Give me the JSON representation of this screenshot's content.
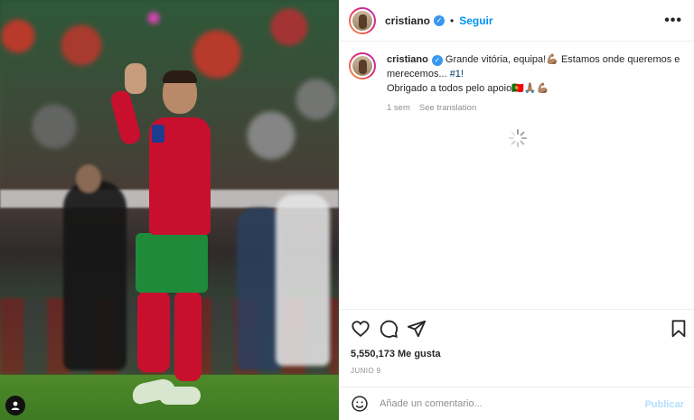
{
  "post": {
    "username": "cristiano",
    "verified": true,
    "follow_label": "Seguir",
    "more_label": "•••"
  },
  "caption": {
    "username": "cristiano",
    "text_1": "Grande vitória, equipa!💪🏽 Estamos onde queremos e merecemos... ",
    "hashtag": "#1!",
    "text_2": "Obrigado a todos pelo apoio🇵🇹🙏🏽💪🏽",
    "time_ago": "1 sem",
    "see_translation": "See translation"
  },
  "stats": {
    "likes": "5,550,173 Me gusta",
    "date": "JUNIO 9"
  },
  "comment": {
    "placeholder": "Añade un comentario...",
    "post_label": "Publicar"
  },
  "colors": {
    "accent": "#0095f6",
    "verified_badge": "#3897f0",
    "post_disabled": "#b2dffc",
    "muted_text": "#8e8e8e"
  },
  "icons": [
    "user-tag-icon",
    "verified-icon",
    "more-options-icon",
    "heart-icon",
    "comment-icon",
    "share-icon",
    "bookmark-icon",
    "emoji-icon",
    "loading-spinner-icon"
  ]
}
